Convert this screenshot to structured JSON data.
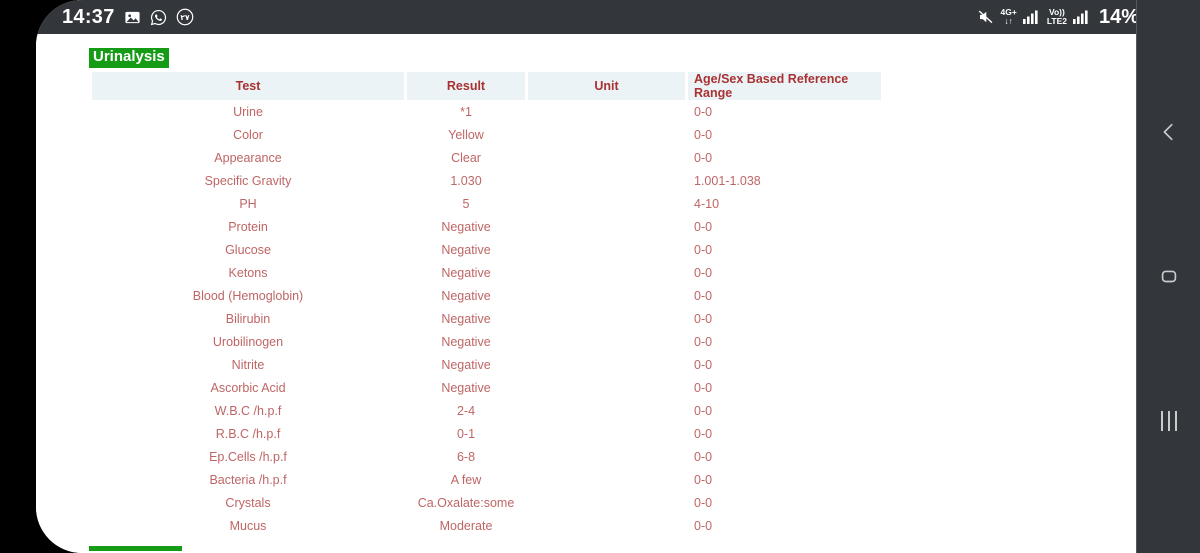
{
  "status_bar": {
    "clock": "14:37",
    "left_icons": [
      {
        "name": "gallery-icon",
        "glyph": "image"
      },
      {
        "name": "whatsapp-icon",
        "glyph": "whatsapp"
      },
      {
        "name": "notification-count-badge",
        "glyph": "٢٧"
      }
    ],
    "right": {
      "mute_icon": "volume-mute-icon",
      "network_type": "4G+",
      "network_arrows": "↓↑",
      "volte_top": "Vo))",
      "volte_bottom": "LTE2",
      "battery_percent": "14%"
    }
  },
  "page": {
    "section_title": "Urinalysis",
    "columns": [
      "Test",
      "Result",
      "Unit",
      "Age/Sex Based Reference Range"
    ],
    "rows": [
      {
        "test": "Urine",
        "result": "*1",
        "unit": "",
        "range": "0-0"
      },
      {
        "test": "Color",
        "result": "Yellow",
        "unit": "",
        "range": "0-0"
      },
      {
        "test": "Appearance",
        "result": "Clear",
        "unit": "",
        "range": "0-0"
      },
      {
        "test": "Specific Gravity",
        "result": "1.030",
        "unit": "",
        "range": "1.001-1.038"
      },
      {
        "test": "PH",
        "result": "5",
        "unit": "",
        "range": "4-10"
      },
      {
        "test": "Protein",
        "result": "Negative",
        "unit": "",
        "range": "0-0"
      },
      {
        "test": "Glucose",
        "result": "Negative",
        "unit": "",
        "range": "0-0"
      },
      {
        "test": "Ketons",
        "result": "Negative",
        "unit": "",
        "range": "0-0"
      },
      {
        "test": "Blood (Hemoglobin)",
        "result": "Negative",
        "unit": "",
        "range": "0-0"
      },
      {
        "test": "Bilirubin",
        "result": "Negative",
        "unit": "",
        "range": "0-0"
      },
      {
        "test": "Urobilinogen",
        "result": "Negative",
        "unit": "",
        "range": "0-0"
      },
      {
        "test": "Nitrite",
        "result": "Negative",
        "unit": "",
        "range": "0-0"
      },
      {
        "test": "Ascorbic Acid",
        "result": "Negative",
        "unit": "",
        "range": "0-0"
      },
      {
        "test": "W.B.C /h.p.f",
        "result": "2-4",
        "unit": "",
        "range": "0-0"
      },
      {
        "test": "R.B.C /h.p.f",
        "result": "0-1",
        "unit": "",
        "range": "0-0"
      },
      {
        "test": "Ep.Cells /h.p.f",
        "result": "6-8",
        "unit": "",
        "range": "0-0"
      },
      {
        "test": "Bacteria /h.p.f",
        "result": "A few",
        "unit": "",
        "range": "0-0"
      },
      {
        "test": "Crystals",
        "result": "Ca.Oxalate:some",
        "unit": "",
        "range": "0-0"
      },
      {
        "test": "Mucus",
        "result": "Moderate",
        "unit": "",
        "range": "0-0"
      }
    ]
  },
  "nav_bar": {
    "back_label": "back-button",
    "home_label": "home-button",
    "recents_label": "recents-button"
  },
  "colors": {
    "accent_green": "#169b16",
    "header_text": "#a83232",
    "cell_text": "#bf6565",
    "header_bg": "#ecf3f6",
    "system_bar": "#33373b"
  }
}
